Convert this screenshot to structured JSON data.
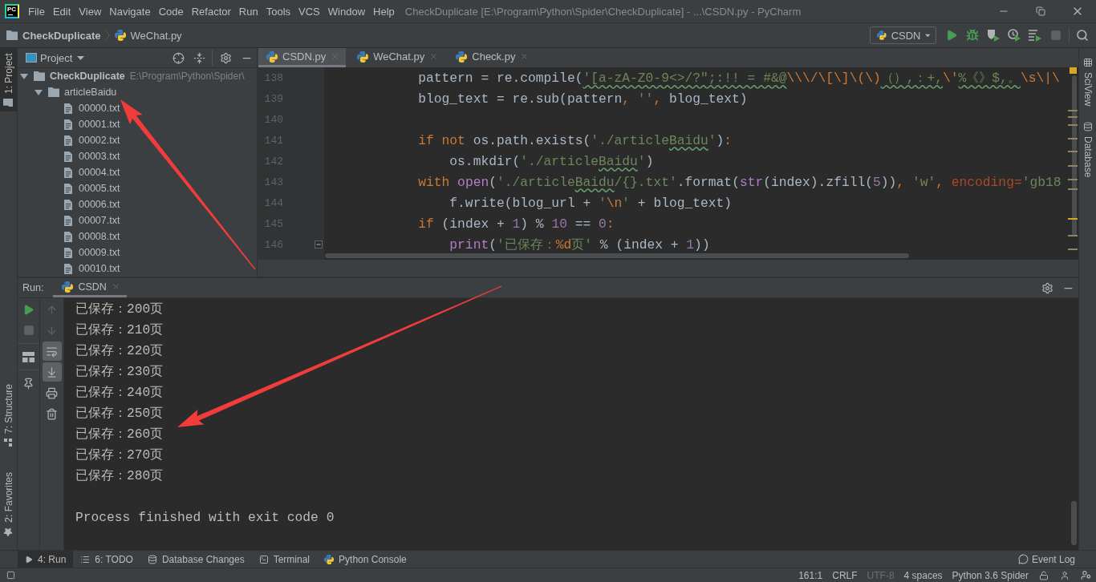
{
  "title_bar": {
    "logo": "PC",
    "menu": [
      "File",
      "Edit",
      "View",
      "Navigate",
      "Code",
      "Refactor",
      "Run",
      "Tools",
      "VCS",
      "Window",
      "Help"
    ],
    "title": "CheckDuplicate [E:\\Program\\Python\\Spider\\CheckDuplicate] - ...\\CSDN.py - PyCharm"
  },
  "navigation_bar": {
    "breadcrumbs": [
      {
        "label": "CheckDuplicate",
        "kind": "folder"
      },
      {
        "label": "WeChat.py",
        "kind": "python"
      }
    ],
    "run_configuration": "CSDN",
    "actions": [
      {
        "kind": "run",
        "disabled": false
      },
      {
        "kind": "debug",
        "disabled": false
      },
      {
        "kind": "coverage",
        "disabled": false
      },
      {
        "kind": "profile",
        "disabled": false
      },
      {
        "kind": "concurrency",
        "disabled": false
      },
      {
        "kind": "stop",
        "disabled": true
      }
    ]
  },
  "left_strip": {
    "top": [
      {
        "label": "1: Project",
        "kind": "project",
        "selected": true
      }
    ],
    "bottom": [
      {
        "label": "7: Structure",
        "kind": "structure",
        "selected": false
      },
      {
        "label": "2: Favorites",
        "kind": "favorites",
        "selected": false
      }
    ]
  },
  "project_panel": {
    "title": "Project",
    "tree": [
      {
        "label": "CheckDuplicate",
        "kind": "root",
        "path": "E:\\Program\\Python\\Spider\\",
        "expanded": true,
        "children": [
          {
            "label": "articleBaidu",
            "kind": "folder",
            "expanded": true,
            "children": [
              {
                "label": "00000.txt",
                "kind": "file"
              },
              {
                "label": "00001.txt",
                "kind": "file"
              },
              {
                "label": "00002.txt",
                "kind": "file"
              },
              {
                "label": "00003.txt",
                "kind": "file"
              },
              {
                "label": "00004.txt",
                "kind": "file"
              },
              {
                "label": "00005.txt",
                "kind": "file"
              },
              {
                "label": "00006.txt",
                "kind": "file"
              },
              {
                "label": "00007.txt",
                "kind": "file"
              },
              {
                "label": "00008.txt",
                "kind": "file"
              },
              {
                "label": "00009.txt",
                "kind": "file"
              },
              {
                "label": "00010.txt",
                "kind": "file"
              }
            ]
          }
        ]
      }
    ]
  },
  "editor": {
    "tabs": [
      {
        "label": "CSDN.py",
        "selected": true
      },
      {
        "label": "WeChat.py",
        "selected": false
      },
      {
        "label": "Check.py",
        "selected": false
      }
    ],
    "lines": [
      {
        "number": "138",
        "fold": false,
        "tokens": [
          {
            "kind": "plain",
            "text": "            pattern = re.compile("
          },
          {
            "kind": "typo",
            "text": "'[a-zA-Z0-9<>/?\";:!! = #&@"
          },
          {
            "kind": "escape",
            "text": "\\\\\\/\\[\\]\\(\\)"
          },
          {
            "kind": "typo",
            "text": "（）,：+,"
          },
          {
            "kind": "escape",
            "text": "\\'"
          },
          {
            "kind": "typo",
            "text": "%《》$,。"
          },
          {
            "kind": "escape",
            "text": "\\s\\|\\"
          }
        ]
      },
      {
        "number": "139",
        "fold": false,
        "tokens": [
          {
            "kind": "plain",
            "text": "            blog_text = re.sub(pattern"
          },
          {
            "kind": "punct",
            "text": ", "
          },
          {
            "kind": "string",
            "text": "''"
          },
          {
            "kind": "punct",
            "text": ", "
          },
          {
            "kind": "plain",
            "text": "blog_text)"
          }
        ]
      },
      {
        "number": "140",
        "fold": false
      },
      {
        "number": "141",
        "fold": false,
        "tokens": [
          {
            "kind": "keyword",
            "text": "            if not"
          },
          {
            "kind": "plain",
            "text": " os.path.exists("
          },
          {
            "kind": "string",
            "text": "'./article"
          },
          {
            "kind": "typo",
            "text": "Baidu"
          },
          {
            "kind": "string",
            "text": "'"
          },
          {
            "kind": "plain",
            "text": ")"
          },
          {
            "kind": "punct",
            "text": ":"
          }
        ]
      },
      {
        "number": "142",
        "fold": false,
        "tokens": [
          {
            "kind": "plain",
            "text": "                os.mkdir("
          },
          {
            "kind": "string",
            "text": "'./article"
          },
          {
            "kind": "typo",
            "text": "Baidu"
          },
          {
            "kind": "string",
            "text": "'"
          },
          {
            "kind": "plain",
            "text": ")"
          }
        ]
      },
      {
        "number": "143",
        "fold": false,
        "tokens": [
          {
            "kind": "keyword",
            "text": "            with "
          },
          {
            "kind": "builtin",
            "text": "open"
          },
          {
            "kind": "plain",
            "text": "("
          },
          {
            "kind": "string",
            "text": "'./article"
          },
          {
            "kind": "typo",
            "text": "Baidu"
          },
          {
            "kind": "string",
            "text": "/{}.txt'"
          },
          {
            "kind": "plain",
            "text": ".format("
          },
          {
            "kind": "builtin",
            "text": "str"
          },
          {
            "kind": "plain",
            "text": "(index).zfill("
          },
          {
            "kind": "number",
            "text": "5"
          },
          {
            "kind": "plain",
            "text": "))"
          },
          {
            "kind": "punct",
            "text": ", "
          },
          {
            "kind": "string",
            "text": "'w'"
          },
          {
            "kind": "punct",
            "text": ", "
          },
          {
            "kind": "param",
            "text": "encoding="
          },
          {
            "kind": "string",
            "text": "'gb18"
          }
        ]
      },
      {
        "number": "144",
        "fold": false,
        "tokens": [
          {
            "kind": "plain",
            "text": "                f.write(blog_url + "
          },
          {
            "kind": "string",
            "text": "'"
          },
          {
            "kind": "escape",
            "text": "\\n"
          },
          {
            "kind": "string",
            "text": "'"
          },
          {
            "kind": "plain",
            "text": " + blog_text)"
          }
        ]
      },
      {
        "number": "145",
        "fold": false,
        "tokens": [
          {
            "kind": "keyword",
            "text": "            if"
          },
          {
            "kind": "plain",
            "text": " (index + "
          },
          {
            "kind": "number",
            "text": "1"
          },
          {
            "kind": "plain",
            "text": ") % "
          },
          {
            "kind": "number",
            "text": "10"
          },
          {
            "kind": "plain",
            "text": " == "
          },
          {
            "kind": "number",
            "text": "0"
          },
          {
            "kind": "punct",
            "text": ":"
          }
        ]
      },
      {
        "number": "146",
        "fold": true,
        "tokens": [
          {
            "kind": "builtin",
            "text": "                print"
          },
          {
            "kind": "plain",
            "text": "("
          },
          {
            "kind": "string",
            "text": "'已保存："
          },
          {
            "kind": "escape",
            "text": "%d"
          },
          {
            "kind": "string",
            "text": "页'"
          },
          {
            "kind": "plain",
            "text": " % (index + "
          },
          {
            "kind": "number",
            "text": "1"
          },
          {
            "kind": "plain",
            "text": "))"
          }
        ]
      }
    ]
  },
  "right_strip": [
    {
      "label": "SciView",
      "kind": "sciview"
    },
    {
      "label": "Database",
      "kind": "database"
    }
  ],
  "run_panel": {
    "label": "Run:",
    "tabs": [
      {
        "label": "CSDN",
        "selected": true
      }
    ],
    "tool_groups": [
      [
        {
          "kind": "rerun",
          "disabled": false
        },
        {
          "kind": "stop",
          "disabled": true
        }
      ],
      [
        {
          "kind": "layout",
          "disabled": false
        }
      ],
      [
        {
          "kind": "pin",
          "disabled": false
        }
      ]
    ],
    "view_tools": [
      {
        "kind": "up",
        "disabled": true,
        "on": false
      },
      {
        "kind": "down",
        "disabled": true,
        "on": false
      },
      {
        "kind": "wrap",
        "disabled": false,
        "on": true
      },
      {
        "kind": "scroll",
        "disabled": false,
        "on": true
      },
      {
        "kind": "print",
        "disabled": false,
        "on": false
      },
      {
        "kind": "trash",
        "disabled": false,
        "on": false
      }
    ],
    "output": [
      "已保存：200页",
      "已保存：210页",
      "已保存：220页",
      "已保存：230页",
      "已保存：240页",
      "已保存：250页",
      "已保存：260页",
      "已保存：270页",
      "已保存：280页"
    ],
    "exit_message": "Process finished with exit code 0"
  },
  "tool_window_bar": {
    "tabs": [
      {
        "label": "4: Run",
        "kind": "run",
        "selected": true
      },
      {
        "label": "6: TODO",
        "kind": "todo",
        "selected": false
      },
      {
        "label": "Database Changes",
        "kind": "database",
        "selected": false
      },
      {
        "label": "Terminal",
        "kind": "terminal",
        "selected": false
      },
      {
        "label": "Python Console",
        "kind": "python",
        "selected": false
      }
    ],
    "event_log": "Event Log"
  },
  "status_bar": {
    "items": [
      {
        "label": "161:1",
        "disabled": false
      },
      {
        "label": "CRLF",
        "disabled": false
      },
      {
        "label": "UTF-8",
        "disabled": true
      },
      {
        "label": "4 spaces",
        "disabled": false
      },
      {
        "label": "Python 3.6 Spider",
        "disabled": false
      }
    ]
  }
}
